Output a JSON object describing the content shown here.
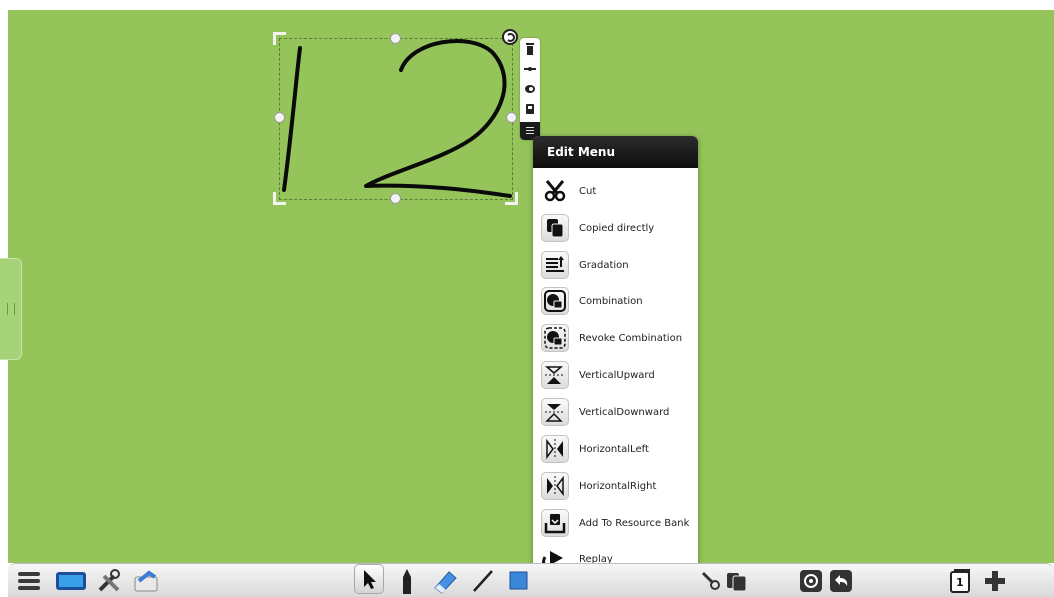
{
  "colors": {
    "canvas_background": "#95c55a",
    "ink": "#0a0a0a",
    "menu_header": "#151515"
  },
  "canvas": {
    "handwriting": "12"
  },
  "selection": {
    "mini_toolbar": [
      "trash-icon",
      "line-icon",
      "attach-icon",
      "copy-icon",
      "menu-icon"
    ]
  },
  "edit_menu": {
    "title": "Edit Menu",
    "items": [
      {
        "label": "Cut",
        "icon": "scissors-icon"
      },
      {
        "label": "Copied directly",
        "icon": "copy-icon"
      },
      {
        "label": "Gradation",
        "icon": "layers-order-icon"
      },
      {
        "label": "Combination",
        "icon": "group-icon"
      },
      {
        "label": "Revoke Combination",
        "icon": "ungroup-icon"
      },
      {
        "label": "VerticalUpward",
        "icon": "flip-up-icon"
      },
      {
        "label": "VerticalDownward",
        "icon": "flip-down-icon"
      },
      {
        "label": "HorizontalLeft",
        "icon": "flip-left-icon"
      },
      {
        "label": "HorizontalRight",
        "icon": "flip-right-icon"
      },
      {
        "label": "Add To Resource Bank",
        "icon": "resource-bank-icon"
      },
      {
        "label": "Replay",
        "icon": "replay-icon"
      }
    ]
  },
  "toolbar": {
    "page_number": "1"
  }
}
